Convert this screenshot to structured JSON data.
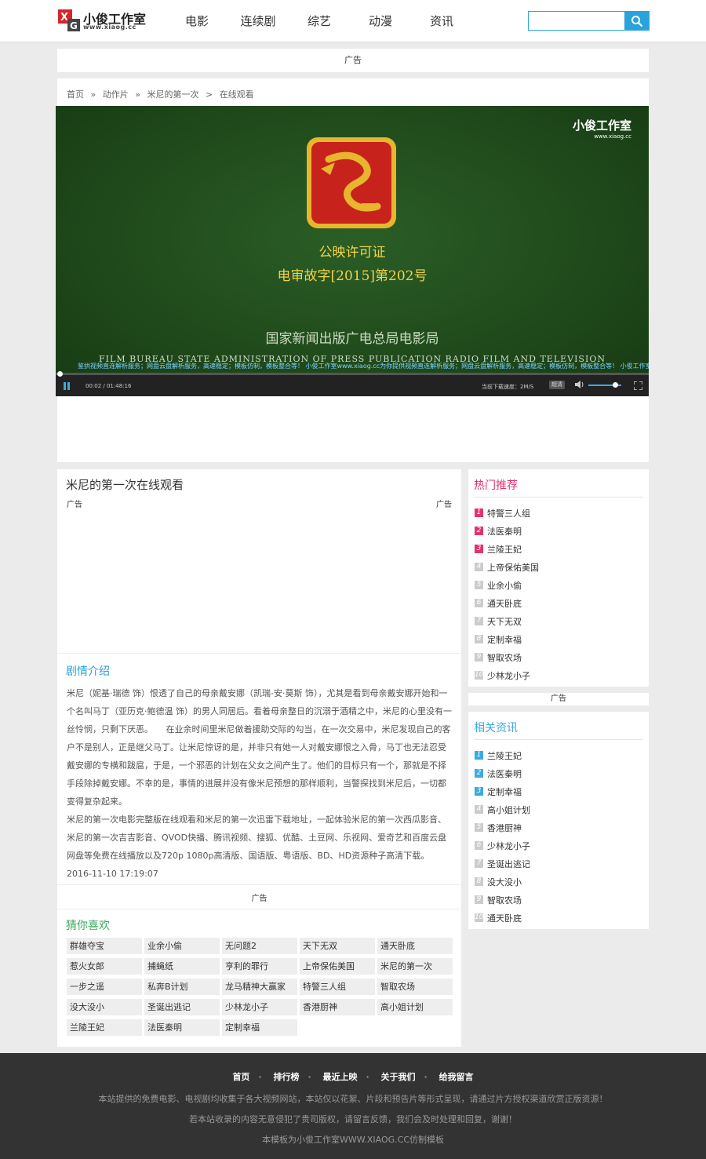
{
  "header": {
    "brand": "小俊工作室",
    "brand_url": "www.xiaog.cc",
    "nav": [
      "电影",
      "连续剧",
      "综艺",
      "动漫",
      "资讯"
    ],
    "search_placeholder": ""
  },
  "top_ad": "广告",
  "breadcrumb": [
    "首页",
    "»",
    "动作片",
    "»",
    "米尼的第一次",
    ">",
    "在线观看"
  ],
  "video": {
    "license_title": "公映许可证",
    "license_number": "电审故字[2015]第202号",
    "authority": "国家新闻出版广电总局电影局",
    "authority_en": "FILM BUREAU STATE ADMINISTRATION OF PRESS PUBLICATION RADIO FILM AND TELEVISION",
    "watermark_brand": "小俊工作室",
    "watermark_url": "www.xiaog.cc",
    "marquee": "鉴拱视频直连解析服务；网盘云盘解析服务，高速稳定；模板仿制，模板整合等！  小俊工作室www.xiaog.cc为你提供视频直连解析服务；网盘云盘解析服务，高速稳定；模板仿制，模板整合等！  小俊工作室",
    "time": "00:02 / 01:48:16",
    "speed": "当前下载速度：2M/S",
    "quality": "超清",
    "progress": 0.003,
    "volume": 0.8,
    "accent": "#3aaae0"
  },
  "main": {
    "title": "米尼的第一次在线观看",
    "ad_left": "广告",
    "ad_right": "广告",
    "plot_title": "剧情介绍",
    "plot_text": "米尼（妮基·瑞德 饰）恨透了自己的母亲戴安娜（凯瑞-安·莫斯 饰），尤其是看到母亲戴安娜开始和一个名叫马丁（亚历克·鲍德温 饰）的男人同居后。看着母亲整日的沉溺于酒精之中，米尼的心里没有一丝怜悯，只剩下厌恶。　　在业余时间里米尼做着援助交际的勾当，在一次交易中，米尼发现自己的客户不是别人，正是继父马丁。让米尼惊讶的是，并非只有她一人对戴安娜恨之入骨，马丁也无法忍受戴安娜的专横和跋扈，于是，一个邪恶的计划在父女之间产生了。他们的目标只有一个，那就是不择手段除掉戴安娜。不幸的是，事情的进展并没有像米尼预想的那样顺利，当警探找到米尼后，一切都变得复杂起来。",
    "plot_text2": "米尼的第一次电影完整版在线观看和米尼的第一次迅雷下载地址，一起体验米尼的第一次西瓜影音、米尼的第一次吉吉影音、QVOD快播、腾讯视频、搜狐、优酷、土豆网、乐视网、爱奇艺和百度云盘网盘等免费在线播放以及720p 1080p高清版、国语版、粤语版、BD、HD资源种子高清下载。 2016-11-10 17:19:07",
    "ad_mid": "广告",
    "like_title": "猜你喜欢",
    "like_items": [
      "群雄夺宝",
      "业余小偷",
      "无问题2",
      "天下无双",
      "通天卧底",
      "惹火女郎",
      "捕蝇纸",
      "亨利的罪行",
      "上帝保佑美国",
      "米尼的第一次",
      "一步之遥",
      "私奔B计划",
      "龙马精神大赢家",
      "特警三人组",
      "智取农场",
      "没大没小",
      "圣诞出逃记",
      "少林龙小子",
      "香港厨神",
      "高小姐计划",
      "兰陵王妃",
      "法医秦明",
      "定制幸福"
    ]
  },
  "sidebar": {
    "hot_title": "热门推荐",
    "hot_items": [
      "特警三人组",
      "法医秦明",
      "兰陵王妃",
      "上帝保佑美国",
      "业余小偷",
      "通天卧底",
      "天下无双",
      "定制幸福",
      "智取农场",
      "少林龙小子"
    ],
    "ad": "广告",
    "news_title": "相关资讯",
    "news_items": [
      "兰陵王妃",
      "法医秦明",
      "定制幸福",
      "高小姐计划",
      "香港厨神",
      "少林龙小子",
      "圣诞出逃记",
      "没大没小",
      "智取农场",
      "通天卧底"
    ],
    "hot_color": "#e4336b",
    "news_color": "#3aaae0",
    "plain_color": "#cccccc"
  },
  "footer": {
    "nav": [
      "首页",
      "排行榜",
      "最近上映",
      "关于我们",
      "给我留言"
    ],
    "line1": "本站提供的免费电影、电视剧均收集于各大视频网站，本站仅以花絮、片段和预告片等形式呈现，请通过片方授权渠道欣赏正版资源！",
    "line2": "若本站收录的内容无意侵犯了贵司版权，请留言反馈，我们会及时处理和回复，谢谢！",
    "line3": "本模板为小俊工作室WWW.XIAOG.CC仿制模板"
  }
}
